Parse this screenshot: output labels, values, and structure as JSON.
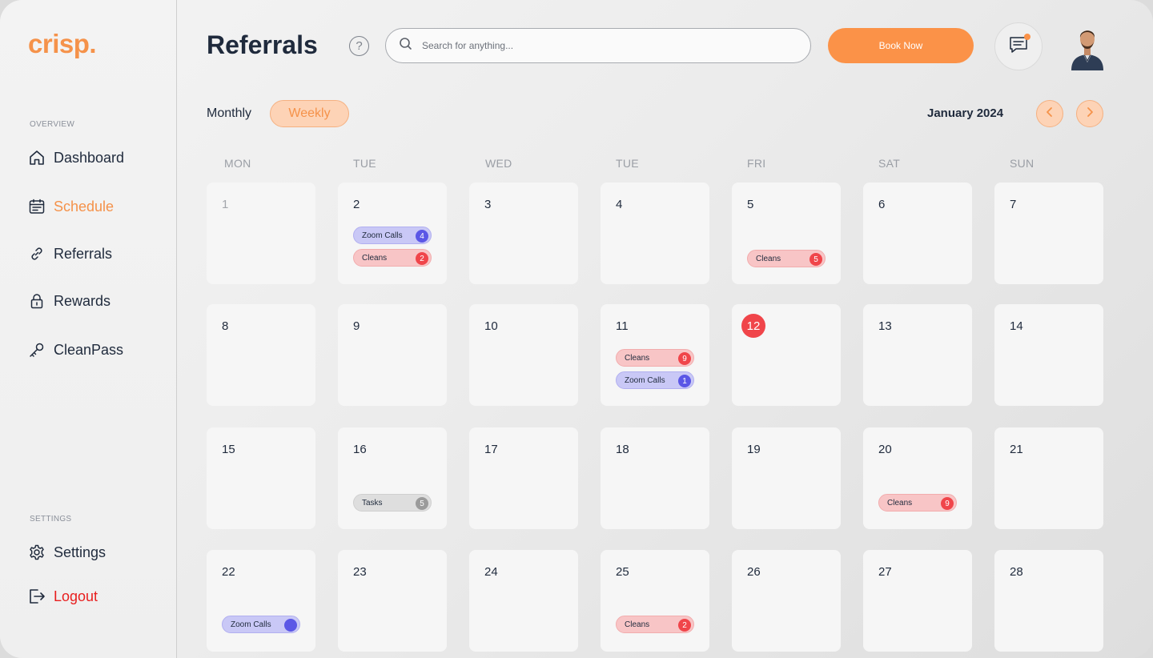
{
  "app": {
    "logo": "crisp."
  },
  "sidebar": {
    "overview_label": "OVERVIEW",
    "settings_label": "SETTINGS",
    "items": [
      {
        "label": "Dashboard",
        "icon": "home-icon"
      },
      {
        "label": "Schedule",
        "icon": "calendar-icon",
        "active": true
      },
      {
        "label": "Referrals",
        "icon": "link-icon"
      },
      {
        "label": "Rewards",
        "icon": "lock-icon"
      },
      {
        "label": "CleanPass",
        "icon": "key-icon"
      }
    ],
    "settings": {
      "label": "Settings",
      "icon": "gear-icon"
    },
    "logout": {
      "label": "Logout",
      "icon": "logout-icon"
    }
  },
  "header": {
    "title": "Referrals",
    "help": "?",
    "search_placeholder": "Search for anything...",
    "book_label": "Book Now"
  },
  "toolbar": {
    "monthly_label": "Monthly",
    "weekly_label": "Weekly",
    "month_label": "January 2024"
  },
  "calendar": {
    "days_of_week": [
      "MON",
      "TUE",
      "WED",
      "TUE",
      "FRI",
      "SAT",
      "SUN"
    ],
    "cells": [
      {
        "day": "1",
        "muted": true,
        "events": []
      },
      {
        "day": "2",
        "events": [
          {
            "type": "zoom",
            "label": "Zoom Calls",
            "count": "4"
          },
          {
            "type": "clean",
            "label": "Cleans",
            "count": "2"
          }
        ]
      },
      {
        "day": "3",
        "events": []
      },
      {
        "day": "4",
        "events": []
      },
      {
        "day": "5",
        "events": [
          {
            "type": "clean",
            "label": "Cleans",
            "count": "5",
            "slot": 2
          }
        ]
      },
      {
        "day": "6",
        "events": []
      },
      {
        "day": "7",
        "events": []
      },
      {
        "day": "8",
        "events": []
      },
      {
        "day": "9",
        "events": []
      },
      {
        "day": "10",
        "events": []
      },
      {
        "day": "11",
        "events": [
          {
            "type": "clean",
            "label": "Cleans",
            "count": "9"
          },
          {
            "type": "zoom",
            "label": "Zoom Calls",
            "count": "1"
          }
        ]
      },
      {
        "day": "12",
        "today": true,
        "events": []
      },
      {
        "day": "13",
        "events": []
      },
      {
        "day": "14",
        "events": []
      },
      {
        "day": "15",
        "events": []
      },
      {
        "day": "16",
        "events": [
          {
            "type": "task",
            "label": "Tasks",
            "count": "5",
            "slot": 3
          }
        ]
      },
      {
        "day": "17",
        "events": []
      },
      {
        "day": "18",
        "events": []
      },
      {
        "day": "19",
        "events": []
      },
      {
        "day": "20",
        "events": [
          {
            "type": "clean",
            "label": "Cleans",
            "count": "9",
            "slot": 3
          }
        ]
      },
      {
        "day": "21",
        "events": []
      },
      {
        "day": "22",
        "events": [
          {
            "type": "zoom",
            "label": "Zoom Calls",
            "count": "",
            "slot": 4
          }
        ]
      },
      {
        "day": "23",
        "events": []
      },
      {
        "day": "24",
        "events": []
      },
      {
        "day": "25",
        "events": [
          {
            "type": "clean",
            "label": "Cleans",
            "count": "2",
            "slot": 4
          }
        ]
      },
      {
        "day": "26",
        "events": []
      },
      {
        "day": "27",
        "events": []
      },
      {
        "day": "28",
        "events": []
      }
    ]
  },
  "colors": {
    "accent": "#fb9248",
    "zoom": "#5b57e6",
    "clean": "#f0454a",
    "task": "#9b9b9b",
    "logout": "#e81e1e"
  }
}
